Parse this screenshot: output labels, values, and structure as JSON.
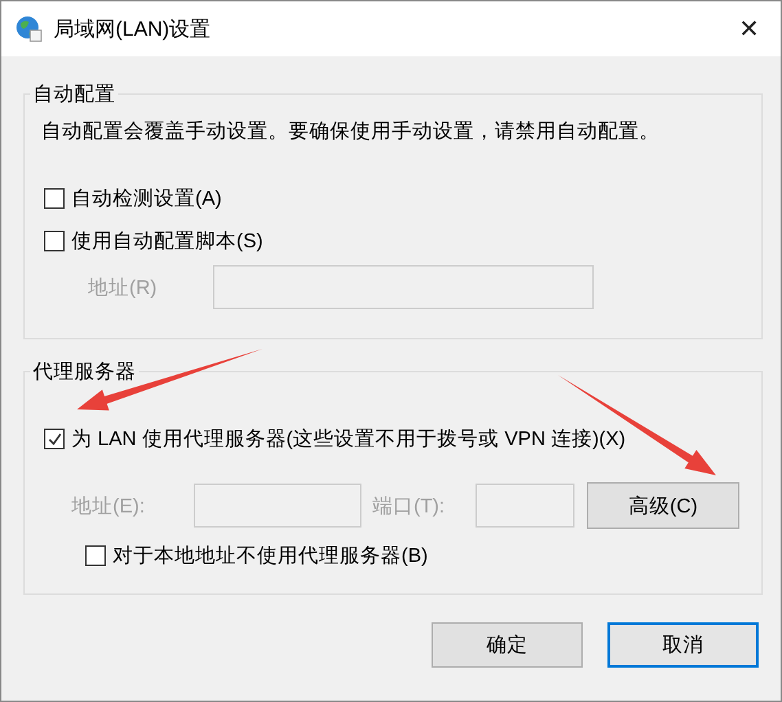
{
  "window": {
    "title": "局域网(LAN)设置",
    "close": "✕"
  },
  "auto_config": {
    "legend": "自动配置",
    "description": "自动配置会覆盖手动设置。要确保使用手动设置，请禁用自动配置。",
    "options": [
      {
        "label": "自动检测设置(A)",
        "checked": false
      },
      {
        "label": "使用自动配置脚本(S)",
        "checked": false
      }
    ],
    "address": {
      "label": "地址(R)",
      "disabled": true
    }
  },
  "proxy": {
    "legend": "代理服务器",
    "use_proxy": {
      "label": "为 LAN 使用代理服务器(这些设置不用于拨号或 VPN 连接)(X)",
      "checked": true
    },
    "address": {
      "label": "地址(E):",
      "disabled": true
    },
    "port": {
      "label": "端口(T):",
      "disabled": true
    },
    "advanced_button": "高级(C)",
    "bypass_local": {
      "label": "对于本地地址不使用代理服务器(B)",
      "checked": false
    }
  },
  "buttons": [
    {
      "label": "确定",
      "focused": false
    },
    {
      "label": "取消",
      "focused": true
    }
  ],
  "annotations": [
    {
      "kind": "arrow",
      "color": "#e8413a"
    },
    {
      "kind": "arrow",
      "color": "#e8413a"
    }
  ]
}
